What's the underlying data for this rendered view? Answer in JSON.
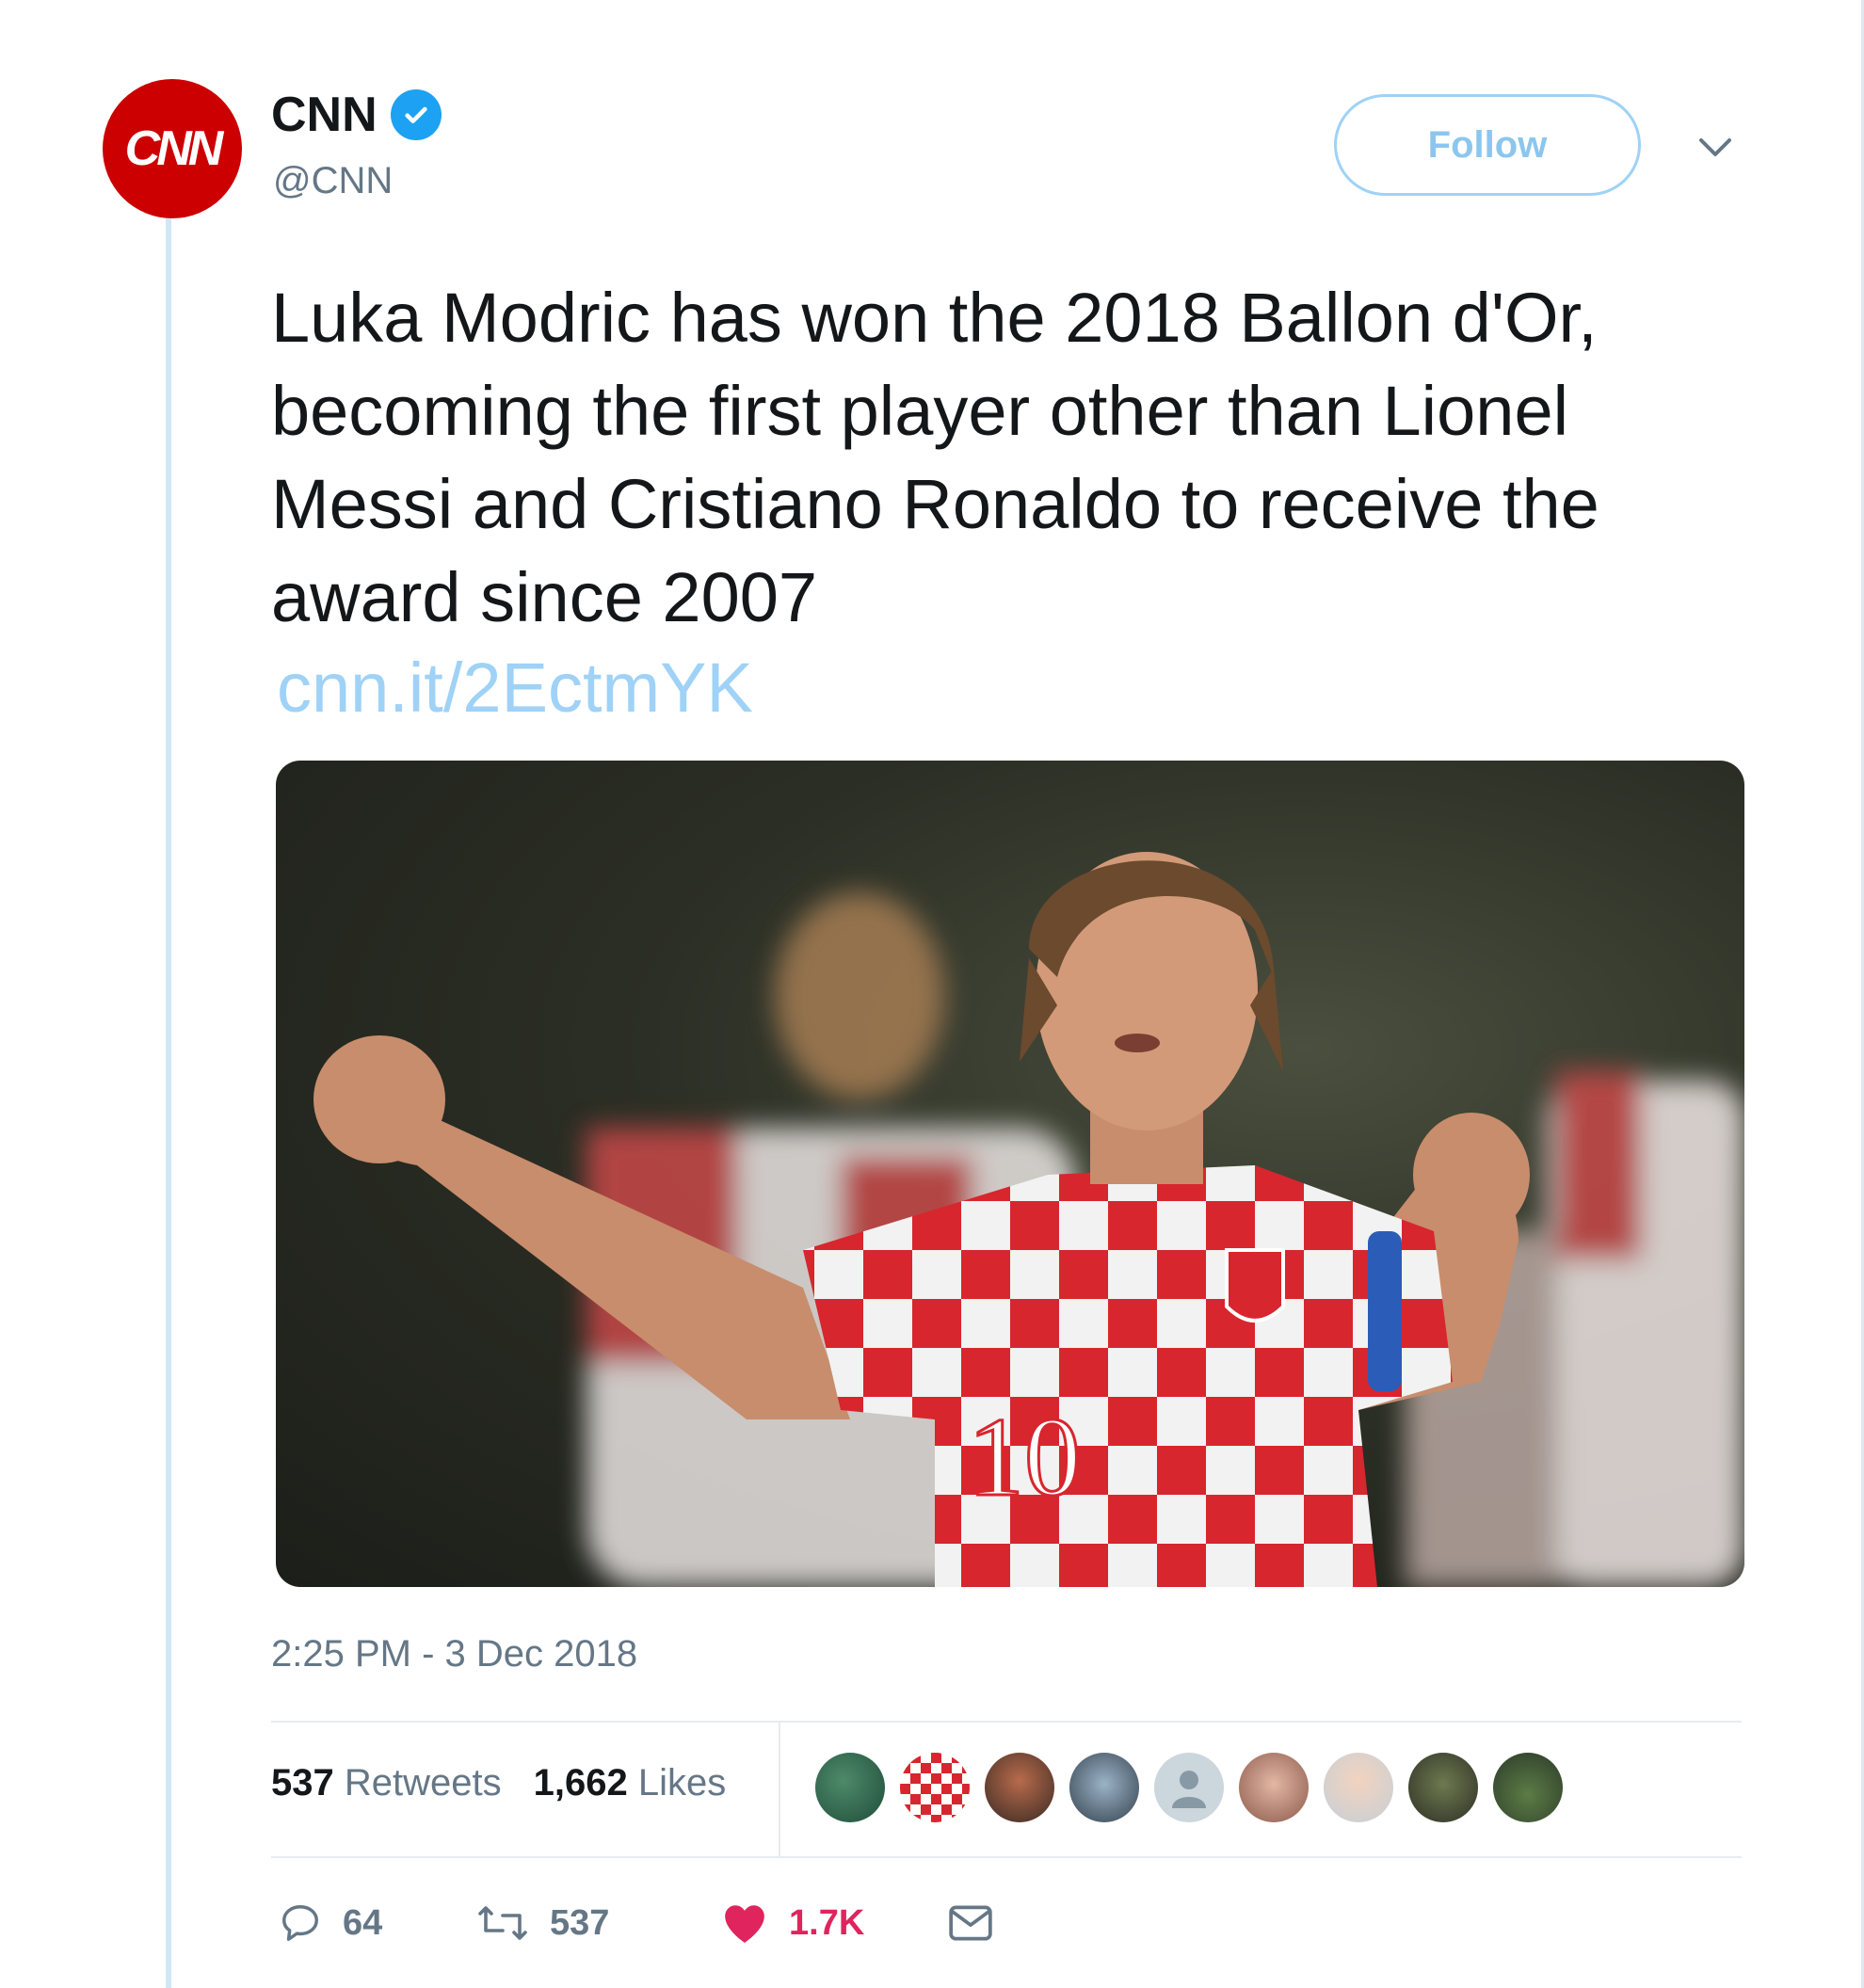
{
  "account": {
    "display_name": "CNN",
    "handle": "@CNN",
    "avatar_text": "CNN",
    "verified": true
  },
  "follow_label": "Follow",
  "tweet": {
    "text": "Luka Modric has won the 2018 Ballon d'Or, becoming the first player other than Lionel Messi and Cristiano Ronaldo to receive the award since 2007",
    "link": "cnn.it/2EctmYK",
    "jersey_number": "10",
    "timestamp": "2:25 PM - 3 Dec 2018"
  },
  "stats": {
    "retweets_count": "537",
    "retweets_label": "Retweets",
    "likes_count": "1,662",
    "likes_label": "Likes"
  },
  "actions": {
    "replies": "64",
    "retweets": "537",
    "likes": "1.7K"
  },
  "colors": {
    "brand_red": "#cc0000",
    "twitter_blue": "#1da1f2",
    "like_red": "#e0245e",
    "link_blue": "#9fd2f6"
  },
  "likers": [
    "liker-1",
    "liker-2",
    "liker-3",
    "liker-4",
    "liker-5",
    "liker-6",
    "liker-7",
    "liker-8",
    "liker-9"
  ]
}
